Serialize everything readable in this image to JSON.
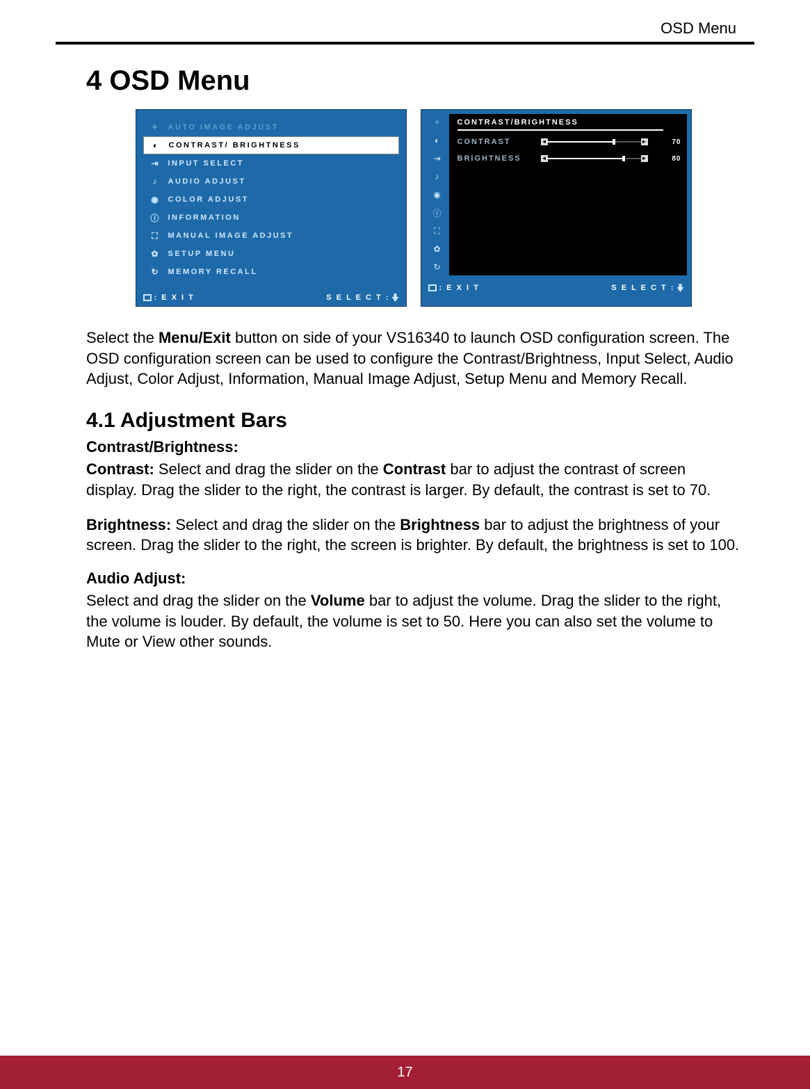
{
  "header": {
    "section_label": "OSD Menu"
  },
  "chapter": {
    "title": "4 OSD Menu"
  },
  "osd_left": {
    "items": [
      {
        "label": "AUTO IMAGE ADJUST",
        "icon": "wand",
        "dim": true
      },
      {
        "label": "CONTRAST/ BRIGHTNESS",
        "icon": "contrast",
        "selected": true
      },
      {
        "label": "INPUT SELECT",
        "icon": "input"
      },
      {
        "label": "AUDIO ADJUST",
        "icon": "audio"
      },
      {
        "label": "COLOR ADJUST",
        "icon": "color"
      },
      {
        "label": "INFORMATION",
        "icon": "info"
      },
      {
        "label": "MANUAL IMAGE ADJUST",
        "icon": "manual"
      },
      {
        "label": "SETUP MENU",
        "icon": "gear"
      },
      {
        "label": "MEMORY RECALL",
        "icon": "recall"
      }
    ],
    "footer": {
      "exit": ": E X I T",
      "select": "S E L E C T :"
    }
  },
  "osd_right": {
    "title": "CONTRAST/BRIGHTNESS",
    "params": [
      {
        "label": "CONTRAST",
        "value": 70,
        "max": 100
      },
      {
        "label": "BRIGHTNESS",
        "value": 80,
        "max": 100
      }
    ],
    "footer": {
      "exit": ": E X I T",
      "select": "S E L E C T :"
    }
  },
  "intro": {
    "text_pre": "Select the ",
    "bold1": "Menu/Exit",
    "text_post": " button on side of your VS16340 to launch OSD configuration screen. The OSD configuration screen can be used to configure the Contrast/Brightness, Input Select, Audio Adjust, Color Adjust, Information, Manual Image Adjust, Setup Menu and Memory Recall."
  },
  "section41": {
    "title": "4.1  Adjustment Bars",
    "cb_head": "Contrast/Brightness:",
    "contrast": {
      "lead": "Contrast:",
      "t1": " Select and drag the slider on the ",
      "b1": "Contrast",
      "t2": " bar to adjust the contrast of screen display. Drag the slider to the right, the contrast is larger. By default, the contrast is set to 70."
    },
    "brightness": {
      "lead": "Brightness:",
      "t1": " Select and drag the slider on the ",
      "b1": "Brightness",
      "t2": " bar to adjust the brightness of your screen. Drag the slider to the right, the screen is brighter. By default, the brightness is set to 100."
    },
    "audio_head": "Audio Adjust:",
    "audio": {
      "t1": "Select and drag the slider on the ",
      "b1": "Volume",
      "t2": " bar to adjust the volume. Drag the slider to the right, the volume is louder. By default, the volume is set to 50. Here you can also set the volume to Mute or View other sounds."
    }
  },
  "footer": {
    "page": "17"
  },
  "icons": {
    "wand": "✦",
    "contrast": "◐",
    "input": "⇥",
    "audio": "♪",
    "color": "◉",
    "info": "ⓘ",
    "manual": "⛶",
    "gear": "✿",
    "recall": "↻"
  }
}
